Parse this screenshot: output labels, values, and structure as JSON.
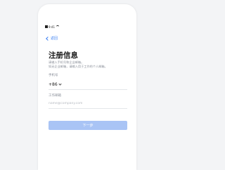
{
  "status_bar": {
    "time_text": "9:41"
  },
  "nav": {
    "back_label": "返回"
  },
  "header": {
    "title": "注册信息",
    "subtitle_line1": "请输入手机号和企业邮箱。",
    "subtitle_line2": "如无企业邮箱，请输入用于工作的个人邮箱。"
  },
  "form": {
    "phone_label": "手机号",
    "country_code": "+86",
    "email_label": "工作邮箱",
    "email_placeholder": "name@company.com",
    "email_value": ""
  },
  "actions": {
    "next_label": "下一步"
  },
  "colors": {
    "accent": "#3b7ff2",
    "button_disabled": "#a9c4f5"
  },
  "icons": {
    "back": "chevron-left-icon",
    "country_dropdown": "chevron-down-icon",
    "signal": "signal-icon",
    "wifi": "wifi-icon"
  }
}
